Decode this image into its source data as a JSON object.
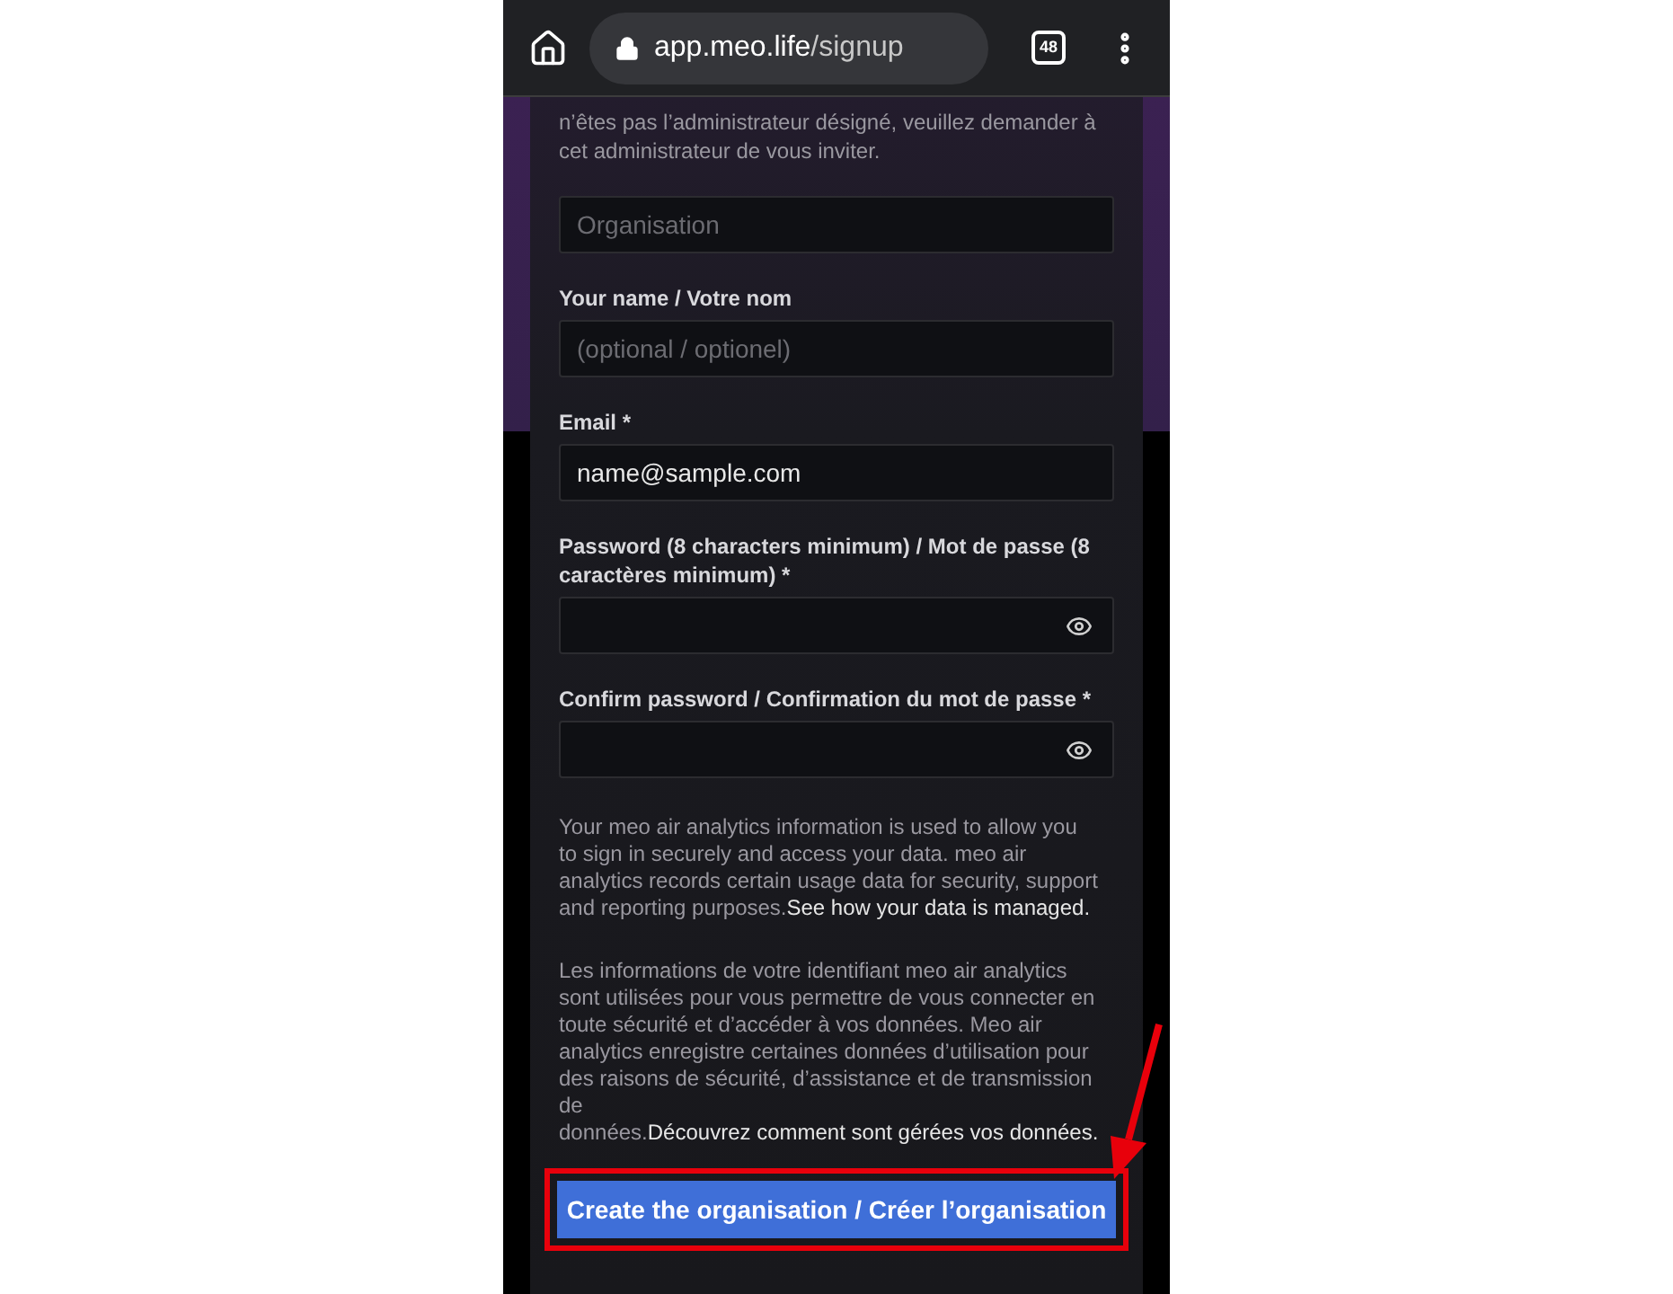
{
  "browser": {
    "url_host": "app.meo.life",
    "url_path": "/signup",
    "tab_count": "48"
  },
  "intro": "n’êtes pas l’administrateur désigné, veuillez demander à cet administrateur de vous inviter.",
  "fields": [
    {
      "placeholder": "Organisation",
      "password": false
    },
    {
      "label": "Your name / Votre nom",
      "placeholder": "(optional / optionel)",
      "password": false
    },
    {
      "label": "Email *",
      "value": "name@sample.com",
      "password": false
    },
    {
      "label": "Password (8 characters minimum) / Mot de passe (8 caractères minimum) *",
      "password": true
    },
    {
      "label": "Confirm password / Confirmation du mot de passe *",
      "password": true
    }
  ],
  "notices": [
    {
      "text": "Your meo air analytics information is used to allow you to sign in securely and access your data. meo air analytics records certain usage data for security, support and reporting purposes.",
      "link": "See how your data is managed."
    },
    {
      "text": "Les informations de votre identifiant meo air analytics sont utilisées pour vous permettre de vous connecter en toute sécurité et d’accéder à vos données. Meo air analytics enregistre certaines données d’utilisation pour des raisons de sécurité, d’assistance et de transmission de données.",
      "link": "Découvrez comment sont gérées vos données."
    }
  ],
  "submit": {
    "label": "Create the organisation / Créer l’organisation",
    "highlighted": true
  }
}
